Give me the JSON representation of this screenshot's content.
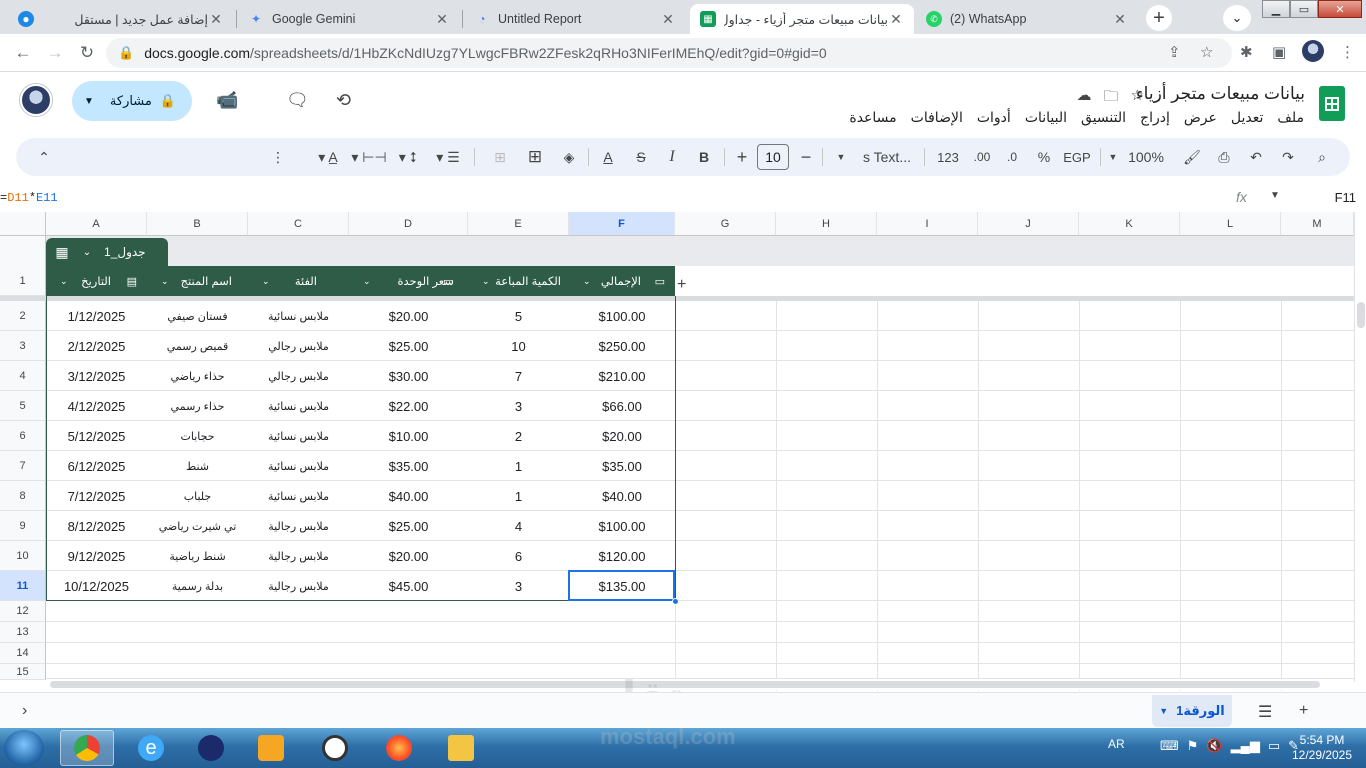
{
  "browser": {
    "tabs": [
      {
        "title": "إضافة عمل جديد | مستقل",
        "icon": "mostaql-icon",
        "color": "#1e88e5"
      },
      {
        "title": "Google Gemini",
        "icon": "gemini-icon",
        "color": "#4285f4"
      },
      {
        "title": "Untitled Report",
        "icon": "looker-icon",
        "color": "#4285f4"
      },
      {
        "title": "بيانات مبيعات متجر أزياء - جداول بيانات",
        "icon": "sheets-icon",
        "color": "#0f9d58"
      },
      {
        "title": "(2) WhatsApp",
        "icon": "whatsapp-icon",
        "color": "#25d366"
      }
    ],
    "url_host": "docs.google.com",
    "url_path": "/spreadsheets/d/1HbZKcNdIUzg7YLwgcFBRw2ZFesk2qRHo3NIFerIMEhQ/edit?gid=0#gid=0"
  },
  "sheets": {
    "title": "بيانات مبيعات متجر أزياء",
    "menu": [
      "ملف",
      "تعديل",
      "عرض",
      "إدراج",
      "التنسيق",
      "البيانات",
      "أدوات",
      "الإضافات",
      "مساعدة"
    ],
    "share_label": "مشاركة",
    "toolbar": {
      "zoom": "100%",
      "currency": "EGP",
      "percent": "%",
      "dec_decrease": ".0",
      "dec_increase": ".00",
      "number_format": "123",
      "font": "s Text...",
      "font_size": "10",
      "bold": "B",
      "italic": "I",
      "text_color": "A"
    },
    "formula": {
      "prefix": "=",
      "ref1": "D11",
      "op": "*",
      "ref2": "E11"
    },
    "name_box": "F11",
    "columns": [
      "A",
      "B",
      "C",
      "D",
      "E",
      "F",
      "G",
      "H",
      "I",
      "J",
      "K",
      "L",
      "M"
    ],
    "selected_column": "F",
    "selected_row": "11",
    "row_numbers": [
      "1",
      "2",
      "3",
      "4",
      "5",
      "6",
      "7",
      "8",
      "9",
      "10",
      "11",
      "12",
      "13",
      "14",
      "15"
    ],
    "table_name": "جدول_1",
    "headers": [
      "التاريخ",
      "اسم المنتج",
      "الفئة",
      "سعر الوحدة",
      "الكمية المباعة",
      "الإجمالي"
    ],
    "rows": [
      [
        "1/12/2025",
        "فستان صيفي",
        "ملابس نسائية",
        "$20.00",
        "5",
        "$100.00"
      ],
      [
        "2/12/2025",
        "قميص رسمي",
        "ملابس رجالي",
        "$25.00",
        "10",
        "$250.00"
      ],
      [
        "3/12/2025",
        "حذاء رياضي",
        "ملابس رجالي",
        "$30.00",
        "7",
        "$210.00"
      ],
      [
        "4/12/2025",
        "حذاء رسمي",
        "ملابس نسائية",
        "$22.00",
        "3",
        "$66.00"
      ],
      [
        "5/12/2025",
        "حجابات",
        "ملابس نسائية",
        "$10.00",
        "2",
        "$20.00"
      ],
      [
        "6/12/2025",
        "شنط",
        "ملابس نسائية",
        "$35.00",
        "1",
        "$35.00"
      ],
      [
        "7/12/2025",
        "جلباب",
        "ملابس نسائية",
        "$40.00",
        "1",
        "$40.00"
      ],
      [
        "8/12/2025",
        "تي شيرت رياضي",
        "ملابس رجالية",
        "$25.00",
        "4",
        "$100.00"
      ],
      [
        "9/12/2025",
        "شنط رياضية",
        "ملابس رجالية",
        "$20.00",
        "6",
        "$120.00"
      ],
      [
        "10/12/2025",
        "بدلة رسمية",
        "ملابس رجالية",
        "$45.00",
        "3",
        "$135.00"
      ]
    ],
    "sheet_tab": "الورقة1"
  },
  "taskbar": {
    "lang": "AR",
    "time": "5:54 PM",
    "date": "12/29/2025"
  },
  "watermark": {
    "arabic": "مستقل",
    "latin": "mostaql.com"
  }
}
